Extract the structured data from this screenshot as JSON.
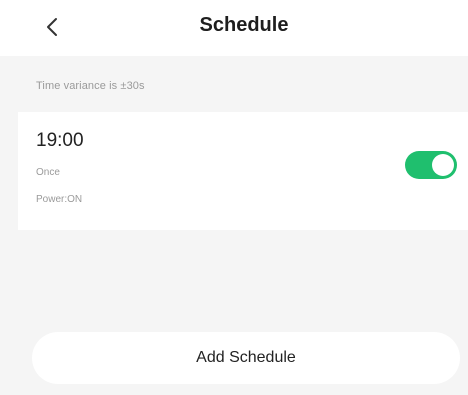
{
  "header": {
    "title": "Schedule",
    "back_icon": "chevron-left-icon"
  },
  "hint": "Time variance is ±30s",
  "schedule": {
    "time": "19:00",
    "repeat": "Once",
    "action": "Power:ON",
    "enabled": true,
    "toggle_color": "#1fbf6e"
  },
  "add_button": {
    "label": "Add Schedule"
  }
}
